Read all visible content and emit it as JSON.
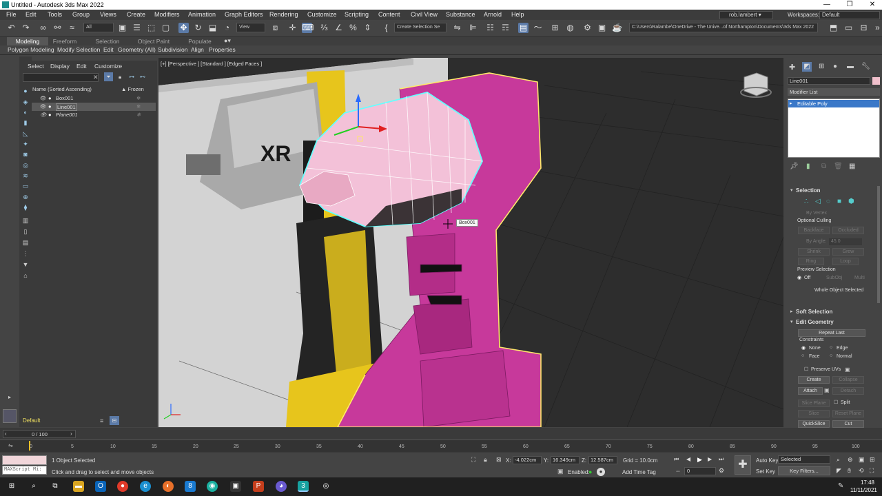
{
  "window": {
    "title": "Untitled - Autodesk 3ds Max 2022",
    "min": "—",
    "restore": "❐",
    "close": "✕"
  },
  "menu": [
    "File",
    "Edit",
    "Tools",
    "Group",
    "Views",
    "Create",
    "Modifiers",
    "Animation",
    "Graph Editors",
    "Rendering",
    "Customize",
    "Scripting",
    "Content",
    "Civil View",
    "Substance",
    "Arnold",
    "Help"
  ],
  "user": {
    "name": "rob.lambert",
    "workspaces_label": "Workspaces:",
    "workspace": "Default"
  },
  "toolbar": {
    "filter": "All",
    "view": "View",
    "selection_set": "Create Selection Se",
    "path": "C:\\Users\\Ralambe\\OneDrive - The Unive...of Northampton\\Documents\\3ds Max 2022"
  },
  "ribbon": {
    "tabs": [
      "Modeling",
      "Freeform",
      "Selection",
      "Object Paint",
      "Populate"
    ],
    "sub": [
      "Polygon Modeling",
      "Modify Selection",
      "Edit",
      "Geometry (All)",
      "Subdivision",
      "Align",
      "Properties"
    ]
  },
  "scene": {
    "menu": [
      "Select",
      "Display",
      "Edit",
      "Customize"
    ],
    "header": "Name (Sorted Ascending)",
    "frozen": "▲ Frozen",
    "items": [
      {
        "name": "Box001"
      },
      {
        "name": "Line001"
      },
      {
        "name": "Plane001"
      }
    ],
    "layer": "Default"
  },
  "viewport": {
    "label": "[+] [Perspective ] [Standard ] [Edged Faces ]",
    "tooltip": "Box001",
    "brand": "XR"
  },
  "panel": {
    "object_name": "Line001",
    "modifier_list": "Modifier List",
    "stack_item": "Editable Poly",
    "selection_title": "Selection",
    "by_vertex": "By Vertex",
    "optional_culling": "Optional Culling",
    "backface": "Backface",
    "occluded": "Occluded",
    "by_angle": "By Angle:",
    "angle": "45.0",
    "shrink": "Shrink",
    "grow": "Grow",
    "ring": "Ring",
    "loop": "Loop",
    "preview_selection": "Preview Selection",
    "off": "Off",
    "subobj": "SubObj",
    "multi": "Multi",
    "whole": "Whole Object Selected",
    "soft_selection": "Soft Selection",
    "edit_geometry": "Edit Geometry",
    "repeat_last": "Repeat Last",
    "constraints": "Constraints",
    "none": "None",
    "edge": "Edge",
    "face": "Face",
    "normal": "Normal",
    "preserve_uvs": "Preserve UVs",
    "create": "Create",
    "collapse": "Collapse",
    "attach": "Attach",
    "detach": "Detach",
    "slice_plane": "Slice Plane",
    "split": "Split",
    "slice": "Slice",
    "reset_plane": "Reset Plane",
    "quickslice": "QuickSlice",
    "cut": "Cut"
  },
  "timeline": {
    "frame": "0 / 100",
    "ticks": [
      "0",
      "5",
      "10",
      "15",
      "20",
      "25",
      "30",
      "35",
      "40",
      "45",
      "50",
      "55",
      "60",
      "65",
      "70",
      "75",
      "80",
      "85",
      "90",
      "95",
      "100"
    ]
  },
  "status": {
    "maxscript": "MAXScript Mi:",
    "selected": "1 Object Selected",
    "hint": "Click and drag to select and move objects",
    "x_label": "X:",
    "x": "-4.022cm",
    "y_label": "Y:",
    "y": "16.349cm",
    "z_label": "Z:",
    "z": "12.587cm",
    "grid": "Grid = 10.0cm",
    "enabled": "Enabled:",
    "add_time_tag": "Add Time Tag",
    "auto_key": "Auto Key",
    "set_key": "Set Key",
    "key_mode": "Selected",
    "key_filters": "Key Filters...",
    "frame_field": "0"
  },
  "taskbar": {
    "time": "17:48",
    "date": "11/11/2021"
  }
}
